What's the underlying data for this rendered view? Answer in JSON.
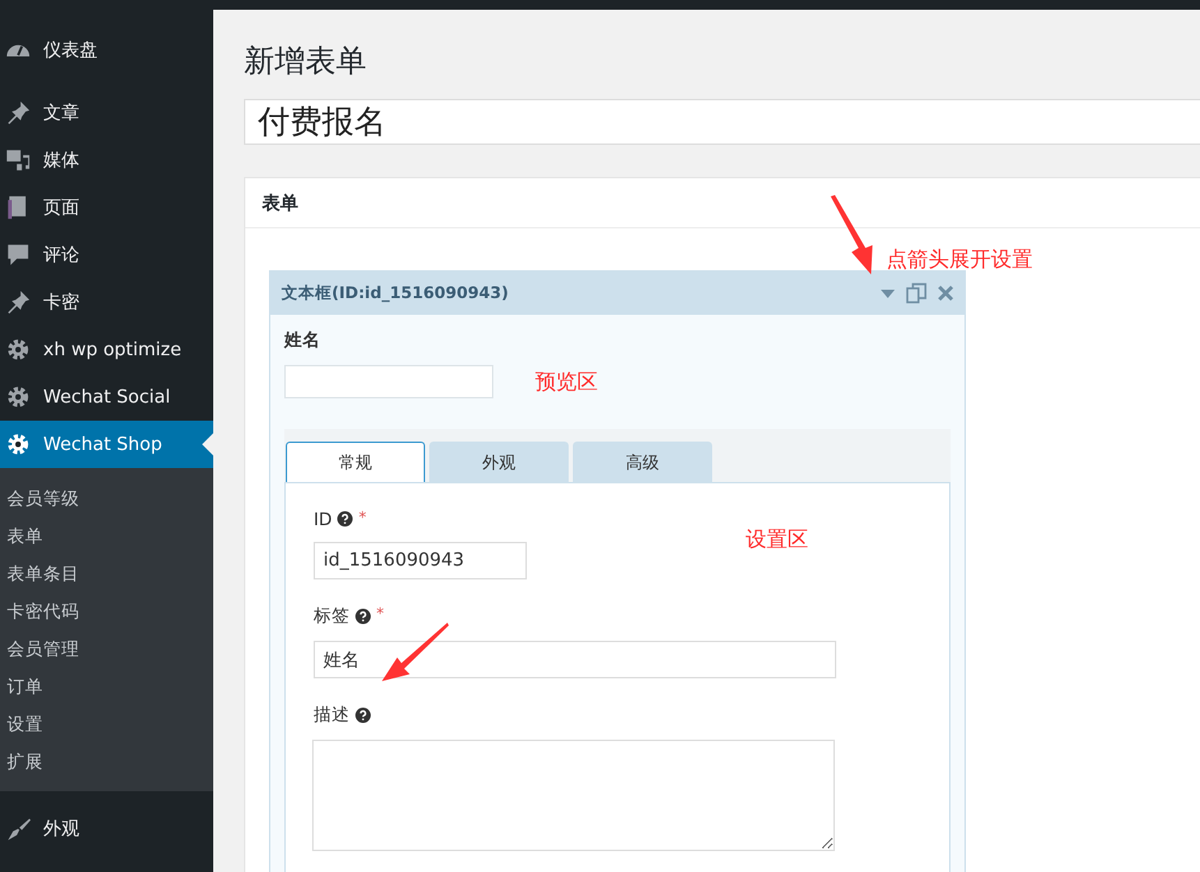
{
  "sidebar": {
    "items": [
      {
        "label": "仪表盘",
        "kind": "dashboard",
        "selected": false
      },
      {
        "label": "文章",
        "kind": "pin",
        "selected": false
      },
      {
        "label": "媒体",
        "kind": "media",
        "selected": false
      },
      {
        "label": "页面",
        "kind": "pages",
        "selected": false
      },
      {
        "label": "评论",
        "kind": "comment",
        "selected": false
      },
      {
        "label": "卡密",
        "kind": "pin",
        "selected": false
      },
      {
        "label": "xh wp optimize",
        "kind": "gear",
        "selected": false
      },
      {
        "label": "Wechat Social",
        "kind": "gear",
        "selected": false
      },
      {
        "label": "Wechat Shop",
        "kind": "gear",
        "selected": true,
        "submenu": [
          "会员等级",
          "表单",
          "表单条目",
          "卡密代码",
          "会员管理",
          "订单",
          "设置",
          "扩展"
        ]
      },
      {
        "label": "外观",
        "kind": "brush",
        "selected": false
      }
    ]
  },
  "page": {
    "title": "新增表单",
    "name_value": "付费报名",
    "postbox": {
      "title": "表单",
      "field": {
        "header": "文本框(ID:id_1516090943)",
        "preview_label": "姓名",
        "tabs": [
          {
            "label": "常规",
            "selected": true
          },
          {
            "label": "外观",
            "selected": false
          },
          {
            "label": "高级",
            "selected": false
          }
        ],
        "settings": [
          {
            "label": "ID",
            "required_mark": "*",
            "kind": "short",
            "value": "id_1516090943"
          },
          {
            "label": "标签",
            "required_mark": "*",
            "kind": "long",
            "value": "姓名"
          },
          {
            "label": "描述",
            "kind": "textarea"
          }
        ]
      }
    }
  },
  "annotations": {
    "expand_hint": "点箭头展开设置",
    "preview_area": "预览区",
    "settings_area": "设置区"
  }
}
